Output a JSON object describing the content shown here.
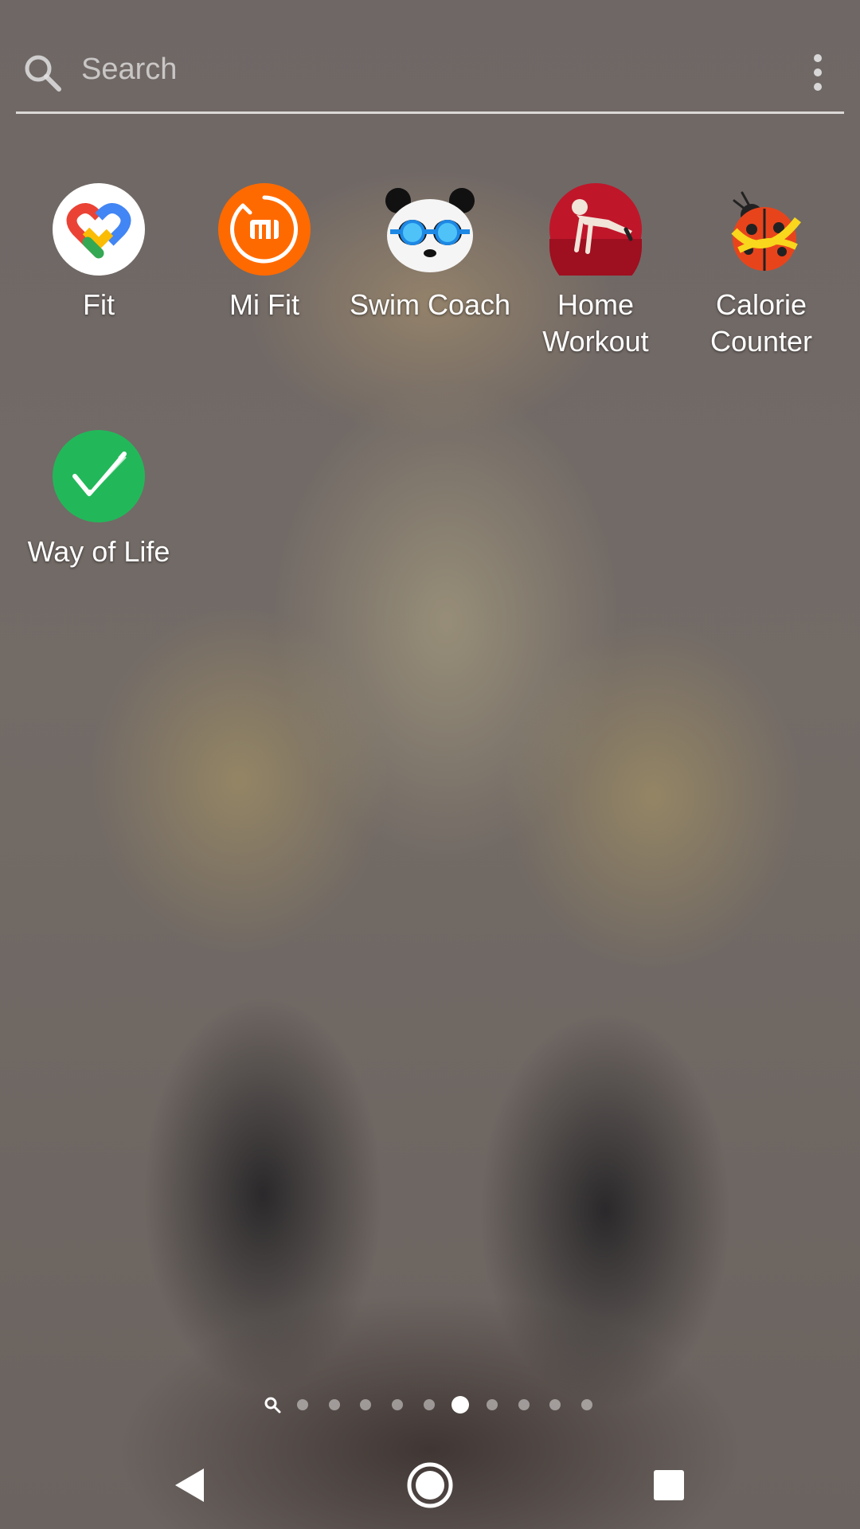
{
  "search": {
    "placeholder": "Search"
  },
  "apps": [
    {
      "label": "Fit",
      "icon": "google-fit-icon"
    },
    {
      "label": "Mi Fit",
      "icon": "mi-fit-icon"
    },
    {
      "label": "Swim Coach",
      "icon": "swim-coach-panda-icon"
    },
    {
      "label": "Home\nWorkout",
      "icon": "home-workout-icon"
    },
    {
      "label": "Calorie\nCounter",
      "icon": "calorie-counter-ladybug-icon"
    },
    {
      "label": "Way of Life",
      "icon": "way-of-life-check-icon"
    }
  ],
  "pager": {
    "page_count": 10,
    "active_page": 6
  },
  "navbar": {
    "back": "back-icon",
    "home": "home-icon",
    "recents": "recents-icon"
  },
  "colors": {
    "mi_fit_orange": "#ff6a00",
    "way_of_life_green": "#22b85a",
    "home_workout_red": "#c0162a"
  }
}
